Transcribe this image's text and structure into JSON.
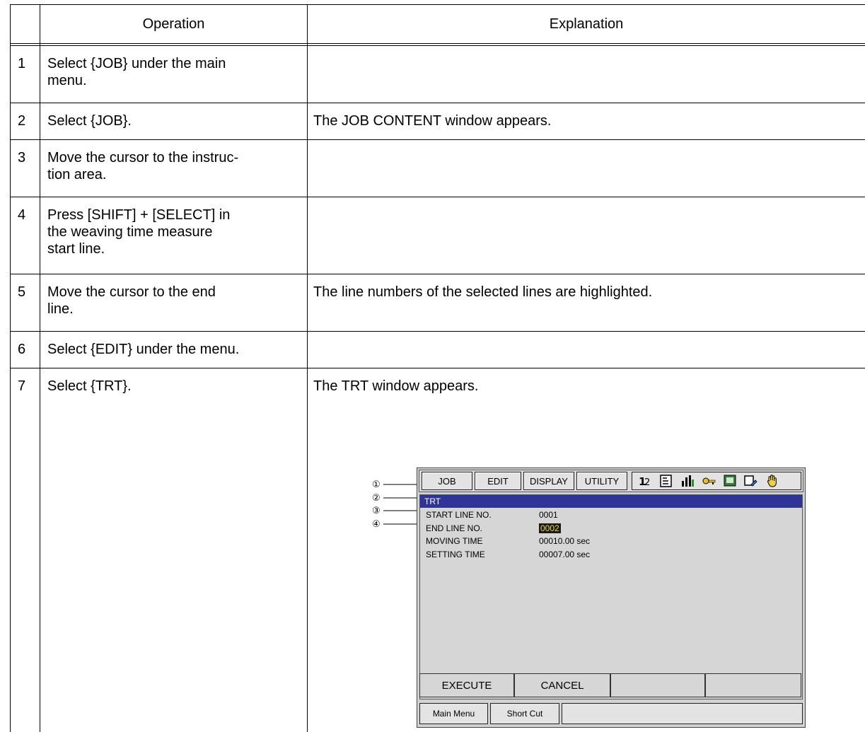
{
  "table": {
    "header": {
      "operation": "Operation",
      "explanation": "Explanation"
    },
    "rows": [
      {
        "num": "1",
        "operation": "Select {JOB} under the main menu.",
        "explanation": ""
      },
      {
        "num": "2",
        "operation": "Select {JOB}.",
        "explanation": "The JOB CONTENT window appears."
      },
      {
        "num": "3",
        "operation": "Move the cursor to the instruction area.",
        "explanation": ""
      },
      {
        "num": "4",
        "operation": "Press [SHIFT] + [SELECT] in the weaving time measure start line.",
        "explanation": ""
      },
      {
        "num": "5",
        "operation": "Move the cursor to the end line.",
        "explanation": "The line numbers of the selected lines are highlighted."
      },
      {
        "num": "6",
        "operation": "Select {EDIT} under the menu.",
        "explanation": ""
      },
      {
        "num": "7",
        "operation": "Select {TRT}.",
        "explanation": "The TRT window appears."
      }
    ],
    "op_lines": {
      "r1": [
        "Select {JOB} under the main",
        "menu."
      ],
      "r3": [
        "Move the cursor to the instruc-",
        "tion area."
      ],
      "r4": [
        "Press [SHIFT] + [SELECT] in",
        "the weaving time measure",
        "start line."
      ],
      "r5": [
        "Move the cursor to the end",
        "line."
      ]
    }
  },
  "screen": {
    "menu": {
      "job": "JOB",
      "edit": "EDIT",
      "display": "DISPLAY",
      "utility": "UTILITY"
    },
    "status_icons": [
      "sort-icon",
      "document-icon",
      "chart-icon",
      "key-icon",
      "monitor-icon",
      "edit-icon",
      "hand-icon"
    ],
    "window_title": "TRT",
    "fields": [
      {
        "callout": "①",
        "label": "START LINE NO.",
        "value": "0001"
      },
      {
        "callout": "②",
        "label": "END LINE NO.",
        "value": "0002"
      },
      {
        "callout": "③",
        "label": "MOVING TIME",
        "value": "00010.00 sec"
      },
      {
        "callout": "④",
        "label": "SETTING TIME",
        "value": "00007.00 sec"
      }
    ],
    "actions": {
      "execute": "EXECUTE",
      "cancel": "CANCEL"
    },
    "bottom": {
      "main_menu": "Main Menu",
      "short_cut": "Short Cut"
    },
    "colors": {
      "title_bar": "#2e3596",
      "highlight_bg": "#1a1a1a",
      "highlight_fg": "#f3d43b"
    }
  }
}
